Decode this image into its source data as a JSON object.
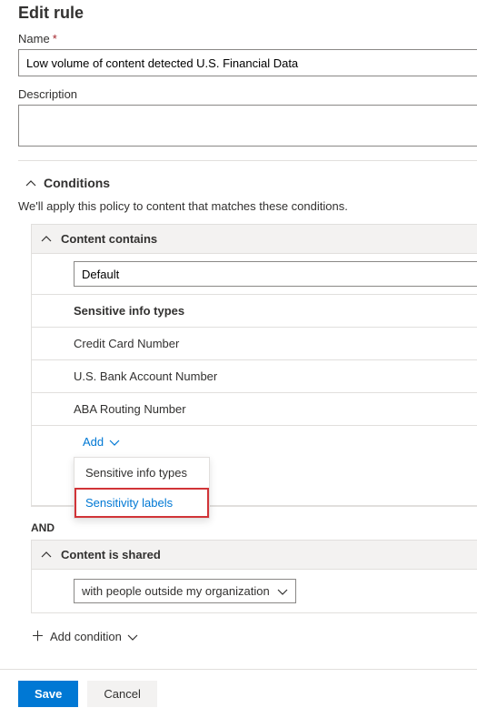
{
  "page_title": "Edit rule",
  "name": {
    "label": "Name",
    "required_mark": "*",
    "value": "Low volume of content detected U.S. Financial Data"
  },
  "description": {
    "label": "Description",
    "value": ""
  },
  "conditions": {
    "title": "Conditions",
    "subtext": "We'll apply this policy to content that matches these conditions.",
    "content_contains": {
      "title": "Content contains",
      "default_value": "Default",
      "sensitive_header": "Sensitive info types",
      "types": [
        "Credit Card Number",
        "U.S. Bank Account Number",
        "ABA Routing Number"
      ],
      "add_label": "Add",
      "menu": {
        "item1": "Sensitive info types",
        "item2": "Sensitivity labels"
      }
    },
    "and_label": "AND",
    "content_shared": {
      "title": "Content is shared",
      "selected": "with people outside my organization"
    },
    "add_condition_label": "Add condition"
  },
  "buttons": {
    "save": "Save",
    "cancel": "Cancel"
  }
}
